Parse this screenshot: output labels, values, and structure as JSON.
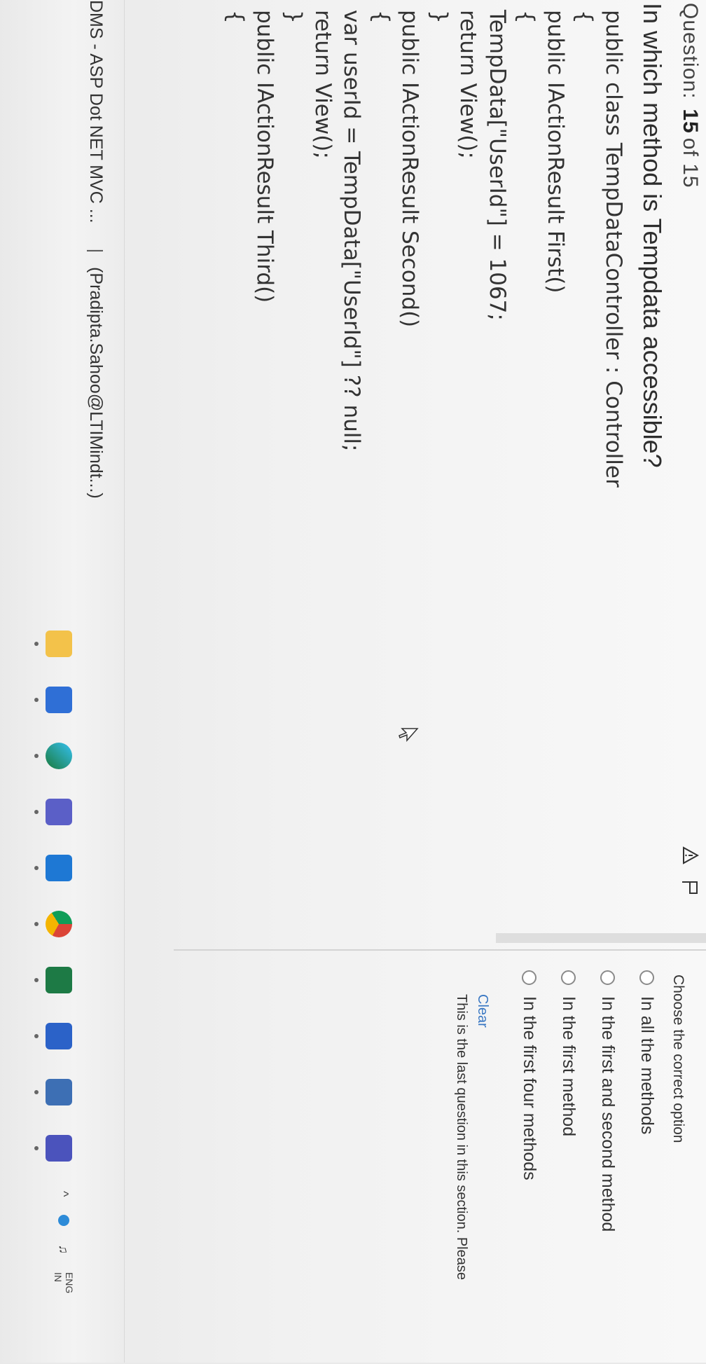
{
  "header": {
    "question_label": "Question:",
    "current": "15",
    "of_label": "of 15"
  },
  "question": {
    "text": "In which method is Tempdata accessible?",
    "code_lines": [
      "public class TempDataController : Controller",
      "{",
      "public IActionResult First()",
      "{",
      "TempData[\"UserId\"] = 1067;",
      "return View();",
      "}",
      "public IActionResult Second()",
      "{",
      "var userId = TempData[\"UserId\"] ?? null;",
      "return View();",
      "}",
      "public IActionResult Third()",
      "{"
    ]
  },
  "answers": {
    "prompt": "Choose the correct option",
    "options": [
      "In all the methods",
      "In the first and second method",
      "In the first method",
      "In the first four methods"
    ],
    "clear_label": "Clear",
    "note": "This is the last question in this section. Please"
  },
  "taskbar": {
    "window_title": "DMS - ASP Dot NET MVC ...",
    "window_user": "(Pradipta.Sahoo@LTIMindt...)",
    "language_top": "ENG",
    "language_bottom": "IN",
    "icons": [
      "file-explorer-icon",
      "microsoft-store-icon",
      "edge-icon",
      "teams-icon",
      "outlook-icon",
      "chrome-icon",
      "excel-icon",
      "word-icon",
      "calculator-icon",
      "teams-chat-icon"
    ]
  },
  "colors": {
    "link": "#3a78c3",
    "background": "#f4f4f4"
  }
}
